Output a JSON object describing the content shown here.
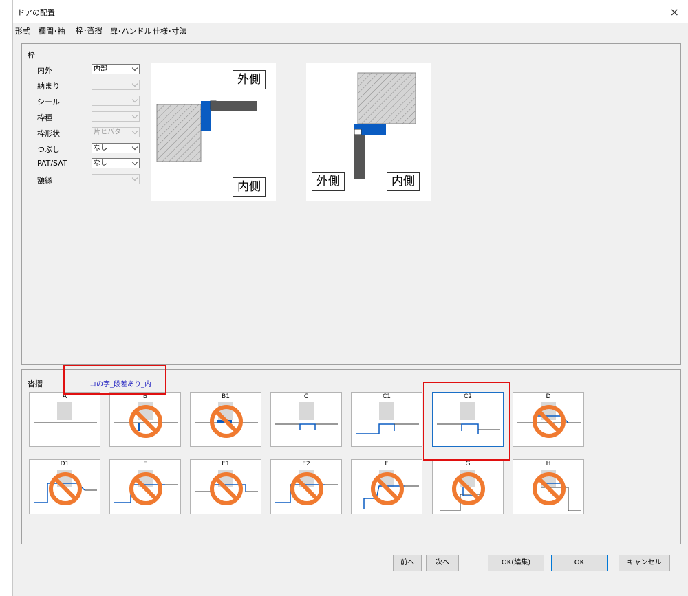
{
  "window": {
    "title": "ドアの配置",
    "close_glyph": "×"
  },
  "tabs": [
    {
      "label": "形式"
    },
    {
      "label": "欄間･袖"
    },
    {
      "label": "枠･沓摺"
    },
    {
      "label": "扉･ハンドル"
    },
    {
      "label": "仕様･寸法"
    }
  ],
  "active_tab": "枠･沓摺",
  "frame": {
    "group_label": "枠",
    "fields": [
      {
        "label": "内外",
        "value": "内部",
        "enabled": true
      },
      {
        "label": "納まり",
        "value": "",
        "enabled": false
      },
      {
        "label": "シール",
        "value": "",
        "enabled": false
      },
      {
        "label": "枠種",
        "value": "",
        "enabled": false
      },
      {
        "label": "枠形状",
        "value": "片ヒバタ",
        "enabled": false
      },
      {
        "label": "つぶし",
        "value": "なし",
        "enabled": true
      },
      {
        "label": "PAT/SAT",
        "value": "なし",
        "enabled": true
      },
      {
        "label": "額縁",
        "value": "",
        "enabled": false
      }
    ],
    "diagram1": {
      "outside_label": "外側",
      "inside_label": "内側"
    },
    "diagram2": {
      "outside_label": "外側",
      "inside_label": "内側"
    }
  },
  "threshold": {
    "group_label": "沓摺",
    "selected_name": "コの字_段差あり_内",
    "selected_option": "C2",
    "options": [
      {
        "label": "A",
        "prohibited": false
      },
      {
        "label": "B",
        "prohibited": true
      },
      {
        "label": "B1",
        "prohibited": true
      },
      {
        "label": "C",
        "prohibited": false
      },
      {
        "label": "C1",
        "prohibited": false
      },
      {
        "label": "C2",
        "prohibited": false
      },
      {
        "label": "D",
        "prohibited": true
      },
      {
        "label": "D1",
        "prohibited": true
      },
      {
        "label": "E",
        "prohibited": true
      },
      {
        "label": "E1",
        "prohibited": true
      },
      {
        "label": "E2",
        "prohibited": true
      },
      {
        "label": "F",
        "prohibited": true
      },
      {
        "label": "G",
        "prohibited": true
      },
      {
        "label": "H",
        "prohibited": true
      }
    ]
  },
  "buttons": {
    "prev": "前へ",
    "next": "次へ",
    "ok_edit": "OK(編集)",
    "ok": "OK",
    "cancel": "キャンセル"
  },
  "colors": {
    "accent_blue": "#0a5cc2",
    "highlight_red": "#e01010",
    "prohibited_orange": "#f07a30",
    "label_blue": "#2020c0"
  }
}
